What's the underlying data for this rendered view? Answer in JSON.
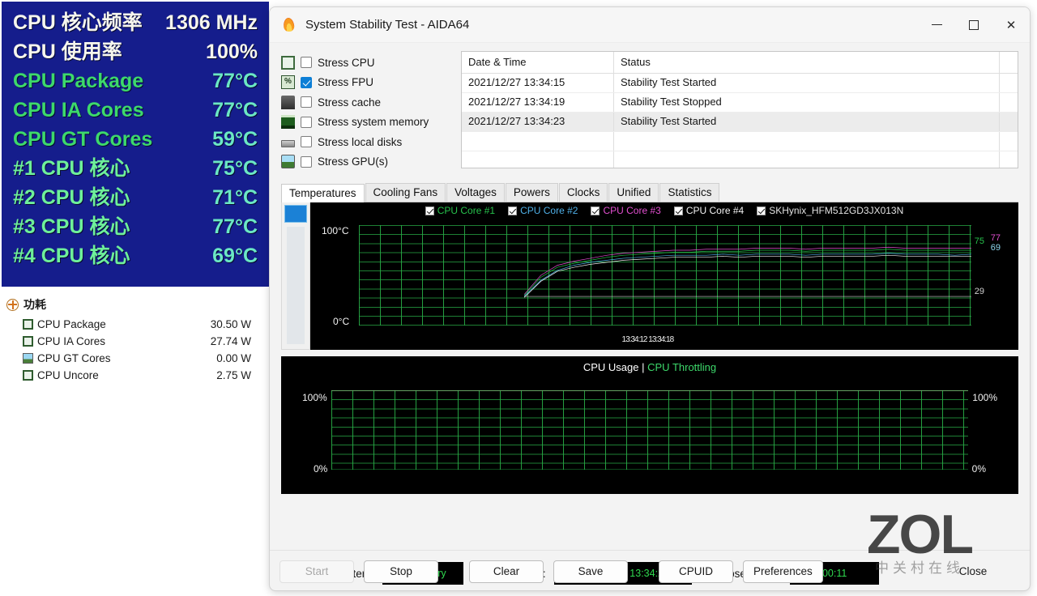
{
  "osd": {
    "rows": [
      {
        "label": "CPU 核心频率",
        "value": "1306 MHz",
        "label_color": "white",
        "value_color": "white"
      },
      {
        "label": "CPU 使用率",
        "value": "100%",
        "label_color": "white",
        "value_color": "white"
      },
      {
        "label": "CPU Package",
        "value": "77°C",
        "label_color": "green",
        "value_color": "cyan"
      },
      {
        "label": "CPU IA Cores",
        "value": "77°C",
        "label_color": "green",
        "value_color": "cyan"
      },
      {
        "label": "CPU GT Cores",
        "value": "59°C",
        "label_color": "green",
        "value_color": "cyan"
      },
      {
        "label": "#1 CPU 核心",
        "value": "75°C",
        "label_color": "green2",
        "value_color": "cyan"
      },
      {
        "label": "#2 CPU 核心",
        "value": "71°C",
        "label_color": "green2",
        "value_color": "cyan"
      },
      {
        "label": "#3 CPU 核心",
        "value": "77°C",
        "label_color": "green2",
        "value_color": "cyan"
      },
      {
        "label": "#4 CPU 核心",
        "value": "69°C",
        "label_color": "green2",
        "value_color": "cyan"
      }
    ],
    "background": "#151d8c"
  },
  "power": {
    "header": "功耗",
    "rows": [
      {
        "name": "CPU Package",
        "value": "30.50 W",
        "icon": "cpu-square-icon"
      },
      {
        "name": "CPU IA Cores",
        "value": "27.74 W",
        "icon": "cpu-square-icon"
      },
      {
        "name": "CPU GT Cores",
        "value": "0.00 W",
        "icon": "gpu-icon"
      },
      {
        "name": "CPU Uncore",
        "value": "2.75 W",
        "icon": "cpu-square-icon"
      }
    ]
  },
  "window": {
    "title": "System Stability Test - AIDA64",
    "icon": "flame-icon",
    "minimize": "–",
    "maximize": "□",
    "close": "✕"
  },
  "stress": {
    "items": [
      {
        "label": "Stress CPU",
        "checked": false,
        "icon": "cpu-chip-icon"
      },
      {
        "label": "Stress FPU",
        "checked": true,
        "icon": "fpu-chip-icon"
      },
      {
        "label": "Stress cache",
        "checked": false,
        "icon": "cache-icon"
      },
      {
        "label": "Stress system memory",
        "checked": false,
        "icon": "memory-module-icon"
      },
      {
        "label": "Stress local disks",
        "checked": false,
        "icon": "hard-disk-icon"
      },
      {
        "label": "Stress GPU(s)",
        "checked": false,
        "icon": "gpu-monitor-icon"
      }
    ]
  },
  "log": {
    "columns": [
      "Date & Time",
      "Status"
    ],
    "rows": [
      {
        "datetime": "2021/12/27 13:34:15",
        "status": "Stability Test Started",
        "selected": false
      },
      {
        "datetime": "2021/12/27 13:34:19",
        "status": "Stability Test Stopped",
        "selected": false
      },
      {
        "datetime": "2021/12/27 13:34:23",
        "status": "Stability Test Started",
        "selected": true
      }
    ]
  },
  "tabs": [
    {
      "label": "Temperatures",
      "active": true
    },
    {
      "label": "Cooling Fans",
      "active": false
    },
    {
      "label": "Voltages",
      "active": false
    },
    {
      "label": "Powers",
      "active": false
    },
    {
      "label": "Clocks",
      "active": false
    },
    {
      "label": "Unified",
      "active": false
    },
    {
      "label": "Statistics",
      "active": false
    }
  ],
  "chart_data": [
    {
      "type": "line",
      "title": "Temperatures",
      "xlabel": "",
      "ylabel": "°C",
      "ylim": [
        0,
        100
      ],
      "y_ticks": [
        "0°C",
        "100°C"
      ],
      "x_tick_label": "13:34:12 13:34:18",
      "grid": true,
      "legend_position": "top",
      "legend": [
        {
          "name": "CPU Core #1",
          "color": "#27c24c",
          "checked": true
        },
        {
          "name": "CPU Core #2",
          "color": "#4fb0e8",
          "checked": true
        },
        {
          "name": "CPU Core #3",
          "color": "#e24fd0",
          "checked": true
        },
        {
          "name": "CPU Core #4",
          "color": "#f2f2f2",
          "checked": true
        },
        {
          "name": "SKHynix_HFM512GD3JX013N",
          "color": "#cfcfcf",
          "checked": true
        }
      ],
      "right_labels": [
        {
          "text": "75",
          "color": "#27c24c",
          "value": 75
        },
        {
          "text": "77",
          "color": "#e24fd0",
          "value": 77
        },
        {
          "text": "69",
          "color": "#8fd8f0",
          "value": 69
        },
        {
          "text": "29",
          "color": "#cfcfcf",
          "value": 29
        }
      ],
      "series": [
        {
          "name": "CPU Core #1",
          "color": "#27c24c",
          "values": [
            30,
            48,
            58,
            62,
            65,
            68,
            70,
            71,
            72,
            73,
            73,
            74,
            74,
            74,
            75,
            75,
            75,
            74,
            75,
            75,
            75,
            75,
            76,
            75,
            75,
            75,
            75,
            75
          ]
        },
        {
          "name": "CPU Core #2",
          "color": "#4fb0e8",
          "values": [
            29,
            45,
            55,
            60,
            63,
            65,
            67,
            68,
            69,
            70,
            70,
            70,
            71,
            70,
            71,
            71,
            71,
            70,
            71,
            71,
            71,
            71,
            72,
            71,
            71,
            71,
            70,
            71
          ]
        },
        {
          "name": "CPU Core #3",
          "color": "#e24fd0",
          "values": [
            31,
            50,
            60,
            64,
            67,
            70,
            72,
            73,
            74,
            75,
            75,
            76,
            76,
            76,
            77,
            77,
            77,
            76,
            77,
            77,
            77,
            77,
            78,
            77,
            77,
            77,
            77,
            77
          ]
        },
        {
          "name": "CPU Core #4",
          "color": "#f2f2f2",
          "values": [
            28,
            44,
            54,
            58,
            61,
            63,
            65,
            66,
            67,
            68,
            68,
            68,
            69,
            68,
            69,
            69,
            69,
            68,
            69,
            69,
            69,
            69,
            70,
            69,
            69,
            69,
            69,
            69
          ]
        },
        {
          "name": "SKHynix_HFM512GD3JX013N",
          "color": "#cfcfcf",
          "values": [
            29,
            29,
            29,
            29,
            29,
            29,
            29,
            29,
            29,
            29,
            29,
            29,
            29,
            29,
            29,
            29,
            29,
            29,
            29,
            29,
            29,
            29,
            29,
            29,
            29,
            29,
            29,
            29
          ]
        }
      ]
    },
    {
      "type": "line",
      "title_primary": "CPU Usage",
      "title_separator": "|",
      "title_secondary": "CPU Throttling",
      "ylim": [
        0,
        100
      ],
      "y_ticks_left": [
        "0%",
        "100%"
      ],
      "y_ticks_right": [
        "0%",
        "100%"
      ],
      "grid": true,
      "series": [
        {
          "name": "CPU Usage",
          "color": "#dedeb0",
          "values": [
            100,
            100,
            100,
            100,
            100,
            100,
            100,
            100,
            100,
            100,
            100,
            100,
            100,
            100,
            100,
            100,
            100,
            100,
            100,
            100,
            100,
            100,
            100,
            100
          ]
        },
        {
          "name": "CPU Throttling",
          "color": "#27c24c",
          "values": [
            0,
            0,
            0,
            0,
            0,
            0,
            0,
            0,
            0,
            0,
            0,
            0,
            0,
            0,
            0,
            0,
            0,
            0,
            0,
            0,
            0,
            0,
            0,
            0
          ]
        }
      ]
    }
  ],
  "status": {
    "battery_label": "Remaining Battery:",
    "battery_value": "No battery",
    "started_label": "Test Started:",
    "started_value": "2021/12/27 13:34:23",
    "elapsed_label": "Elapsed Time:",
    "elapsed_value": "00:11"
  },
  "buttons": {
    "start": "Start",
    "stop": "Stop",
    "clear": "Clear",
    "save": "Save",
    "cpuid": "CPUID",
    "preferences": "Preferences",
    "close": "Close"
  },
  "watermark": {
    "logo": "ZOL",
    "subtitle": "中关村在线"
  }
}
